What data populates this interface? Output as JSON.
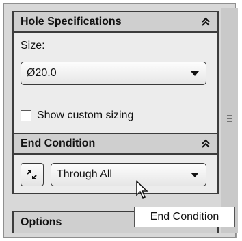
{
  "hole_specifications": {
    "title": "Hole Specifications",
    "size_label": "Size:",
    "size_value": "Ø20.0",
    "show_custom_sizing": {
      "label": "Show custom sizing",
      "checked": false
    }
  },
  "end_condition": {
    "title": "End Condition",
    "reverse_icon": "reverse-direction-icon",
    "value": "Through All",
    "tooltip": "End Condition"
  },
  "options": {
    "title": "Options"
  }
}
